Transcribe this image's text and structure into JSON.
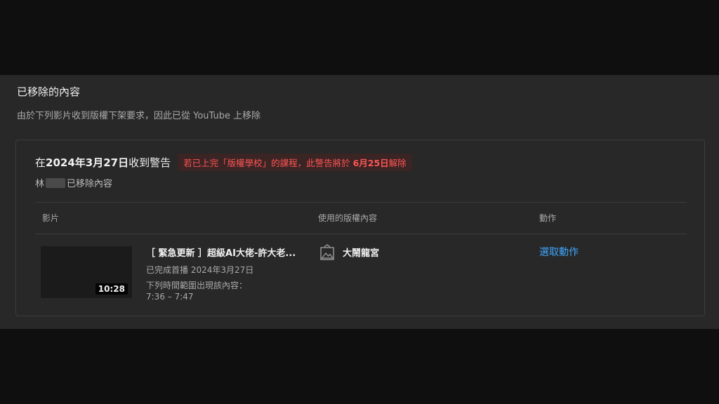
{
  "header": {
    "title": "已移除的內容",
    "subtitle": "由於下列影片收到版權下架要求，因此已從 YouTube 上移除"
  },
  "warning": {
    "prefix": "在 ",
    "date": "2024年3月27日",
    "suffix": "收到警告",
    "notice_prefix": "若已上完「版權學校」的課程，此警告將於 ",
    "notice_date": "6月25日",
    "notice_suffix": "解除"
  },
  "removed_by": {
    "name_initial": "林",
    "text": "已移除內容"
  },
  "table": {
    "columns": [
      "影片",
      "使用的版權內容",
      "動作"
    ],
    "rows": [
      {
        "duration": "10:28",
        "title": "［ 緊急更新 ］超級AI大佬-許大老...",
        "premiere": "已完成首播 2024年3月27日",
        "range_label": "下列時間範圍出現該內容：",
        "range": "7:36 – 7:47",
        "asset_name": "大鬧龍宮",
        "action_label": "選取動作"
      }
    ]
  },
  "colors": {
    "background": "#0f0f0f",
    "panel": "#282828",
    "notice_text": "#ff5555",
    "link": "#3ea6ff"
  },
  "icons": {
    "asset": "image-asset-icon"
  }
}
